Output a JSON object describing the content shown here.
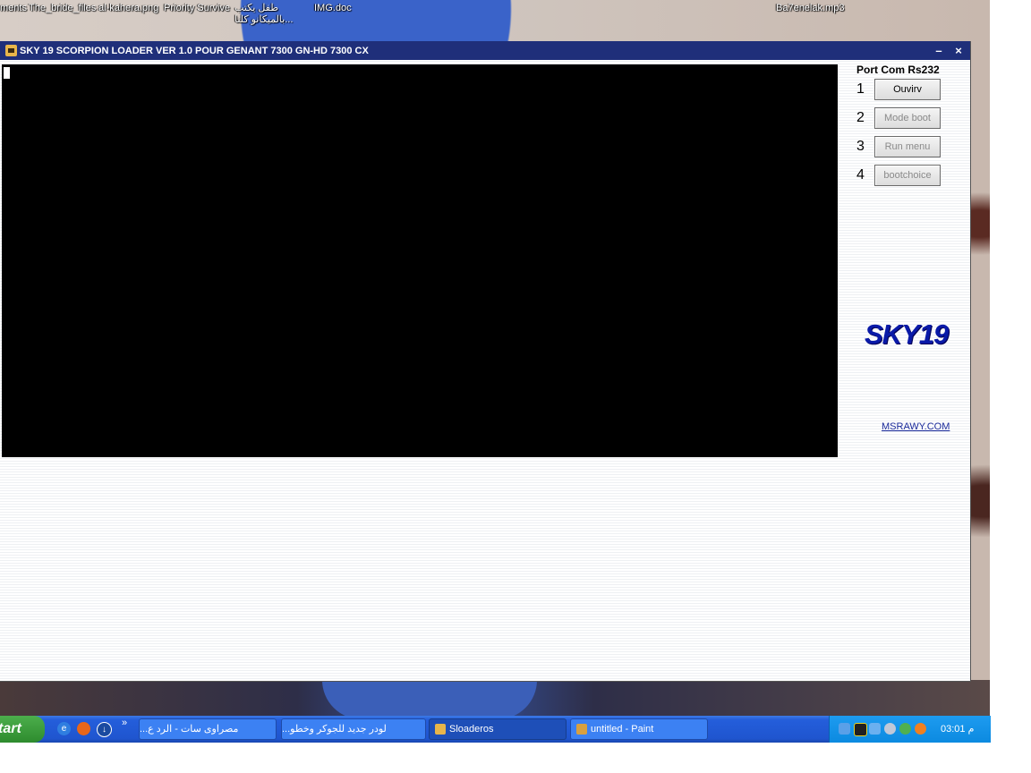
{
  "desktop": {
    "icons": [
      {
        "label": "ments"
      },
      {
        "label": "The_bride_files"
      },
      {
        "label": "al-kahera.png"
      },
      {
        "label": "Priority Survive"
      },
      {
        "label": "طفل يكتب",
        "label2": "...بالميكانو كلنا"
      },
      {
        "label": "IMG.doc"
      },
      {
        "label": "Ba7enelak.mp3"
      }
    ]
  },
  "window": {
    "title": "SKY 19 SCORPION LOADER VER 1.0 POUR GENANT 7300 GN-HD 7300 CX",
    "minimize_glyph": "–",
    "close_glyph": "×"
  },
  "panel": {
    "port_title": "Port Com Rs232",
    "steps": [
      {
        "num": "1",
        "label": "Ouvirv",
        "enabled": true
      },
      {
        "num": "2",
        "label": "Mode boot",
        "enabled": false
      },
      {
        "num": "3",
        "label": "Run menu",
        "enabled": false
      },
      {
        "num": "4",
        "label": "bootchoice",
        "enabled": false
      }
    ],
    "brand": "SKY19",
    "link": "MSRAWY.COM"
  },
  "taskbar": {
    "start_label": "tart",
    "quick_launch": [
      "ie-icon",
      "firefox-icon",
      "download-icon"
    ],
    "overflow": "»",
    "tasks": [
      {
        "label": "مصراوى سات - الرد ع...",
        "icon": "chrome-icon",
        "color": "#e04030"
      },
      {
        "label": "لودر جديد للجوكر وخطو...",
        "icon": "folder-icon",
        "color": "#f2c84b"
      },
      {
        "label": "Sloaderos",
        "icon": "scorpion-icon",
        "color": "#e8b54a"
      },
      {
        "label": "untitled - Paint",
        "icon": "paint-icon",
        "color": "#d8a040"
      }
    ],
    "clock": "03:01 م"
  },
  "colors": {
    "titlebar": "#1f2f7a",
    "brand": "#0a1aa8",
    "console": "#000000"
  }
}
